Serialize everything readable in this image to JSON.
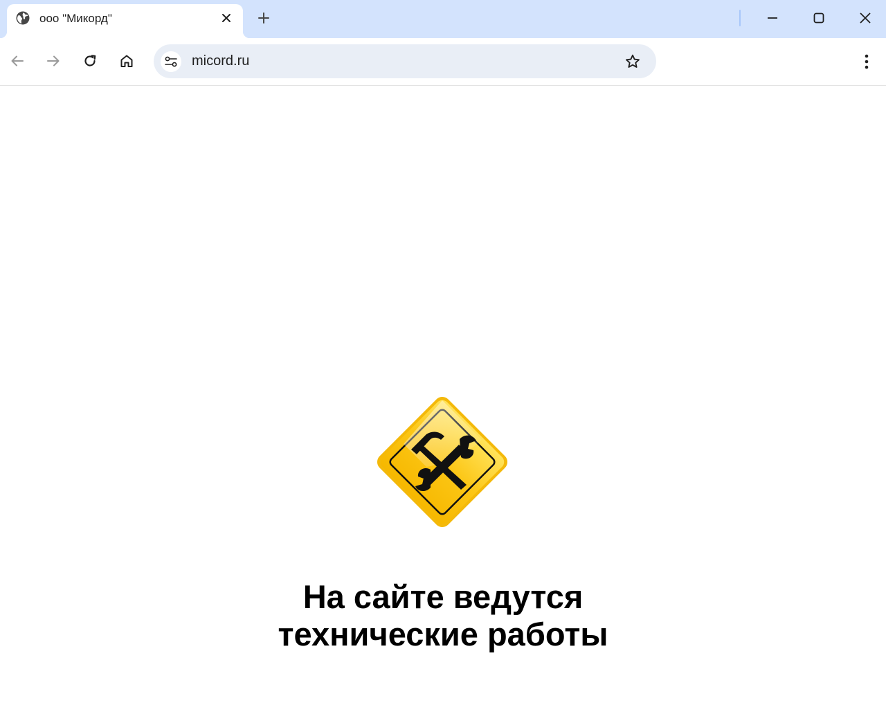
{
  "browser": {
    "tab": {
      "title": "ооо \"Микорд\"",
      "favicon": "globe-icon"
    },
    "address_bar": {
      "url": "micord.ru"
    }
  },
  "page": {
    "heading_line1": "На сайте ведутся",
    "heading_line2": "технические работы",
    "image": "under-construction-sign-icon"
  },
  "colors": {
    "tabbar": "#d3e3fd",
    "omnibox": "#e9eef6",
    "sign_yellow": "#fcc615",
    "text": "#000000"
  }
}
